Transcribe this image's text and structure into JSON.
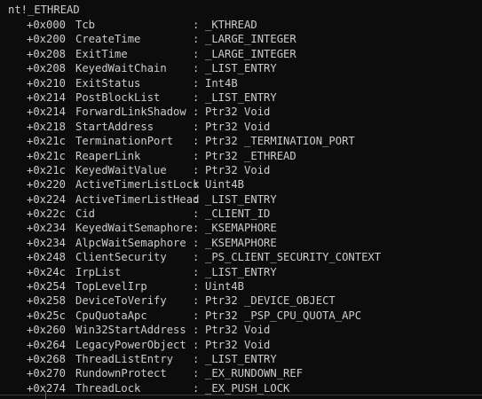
{
  "header": {
    "title": "nt!_ETHREAD"
  },
  "fields": [
    {
      "offset": "+0x000",
      "name": "Tcb",
      "type": "_KTHREAD"
    },
    {
      "offset": "+0x200",
      "name": "CreateTime",
      "type": "_LARGE_INTEGER"
    },
    {
      "offset": "+0x208",
      "name": "ExitTime",
      "type": "_LARGE_INTEGER"
    },
    {
      "offset": "+0x208",
      "name": "KeyedWaitChain",
      "type": "_LIST_ENTRY"
    },
    {
      "offset": "+0x210",
      "name": "ExitStatus",
      "type": "Int4B"
    },
    {
      "offset": "+0x214",
      "name": "PostBlockList",
      "type": "_LIST_ENTRY"
    },
    {
      "offset": "+0x214",
      "name": "ForwardLinkShadow",
      "type": "Ptr32 Void"
    },
    {
      "offset": "+0x218",
      "name": "StartAddress",
      "type": "Ptr32 Void"
    },
    {
      "offset": "+0x21c",
      "name": "TerminationPort",
      "type": "Ptr32 _TERMINATION_PORT"
    },
    {
      "offset": "+0x21c",
      "name": "ReaperLink",
      "type": "Ptr32 _ETHREAD"
    },
    {
      "offset": "+0x21c",
      "name": "KeyedWaitValue",
      "type": "Ptr32 Void"
    },
    {
      "offset": "+0x220",
      "name": "ActiveTimerListLock",
      "type": "Uint4B"
    },
    {
      "offset": "+0x224",
      "name": "ActiveTimerListHead",
      "type": "_LIST_ENTRY"
    },
    {
      "offset": "+0x22c",
      "name": "Cid",
      "type": "_CLIENT_ID"
    },
    {
      "offset": "+0x234",
      "name": "KeyedWaitSemaphore",
      "type": "_KSEMAPHORE"
    },
    {
      "offset": "+0x234",
      "name": "AlpcWaitSemaphore",
      "type": "_KSEMAPHORE"
    },
    {
      "offset": "+0x248",
      "name": "ClientSecurity",
      "type": "_PS_CLIENT_SECURITY_CONTEXT"
    },
    {
      "offset": "+0x24c",
      "name": "IrpList",
      "type": "_LIST_ENTRY"
    },
    {
      "offset": "+0x254",
      "name": "TopLevelIrp",
      "type": "Uint4B"
    },
    {
      "offset": "+0x258",
      "name": "DeviceToVerify",
      "type": "Ptr32 _DEVICE_OBJECT"
    },
    {
      "offset": "+0x25c",
      "name": "CpuQuotaApc",
      "type": "Ptr32 _PSP_CPU_QUOTA_APC"
    },
    {
      "offset": "+0x260",
      "name": "Win32StartAddress",
      "type": "Ptr32 Void"
    },
    {
      "offset": "+0x264",
      "name": "LegacyPowerObject",
      "type": "Ptr32 Void"
    },
    {
      "offset": "+0x268",
      "name": "ThreadListEntry",
      "type": "_LIST_ENTRY"
    },
    {
      "offset": "+0x270",
      "name": "RundownProtect",
      "type": "_EX_RUNDOWN_REF"
    },
    {
      "offset": "+0x274",
      "name": "ThreadLock",
      "type": "_EX_PUSH_LOCK"
    }
  ],
  "separator": ":"
}
